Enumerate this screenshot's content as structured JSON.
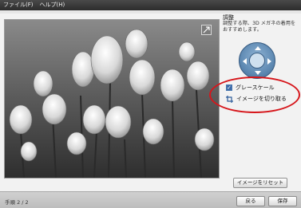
{
  "menubar": {
    "items": [
      "ファイル(F)",
      "ヘルプ(H)"
    ]
  },
  "panel": {
    "title": "調整",
    "description": "調整する際、3D メガネの着用をおすすめします。",
    "grayscale_label": "グレースケール",
    "grayscale_checked": true,
    "crop_label": "イメージを切り取る"
  },
  "buttons": {
    "reset": "イメージをリセット",
    "back": "戻る",
    "save": "保存"
  },
  "footer": {
    "step": "手順 2 / 2"
  },
  "colors": {
    "annotation": "#d6161b",
    "checkbox": "#3c6aa8"
  },
  "icons": [
    "expand-icon",
    "rotate-control-icon",
    "crop-icon",
    "checkmark-icon"
  ]
}
